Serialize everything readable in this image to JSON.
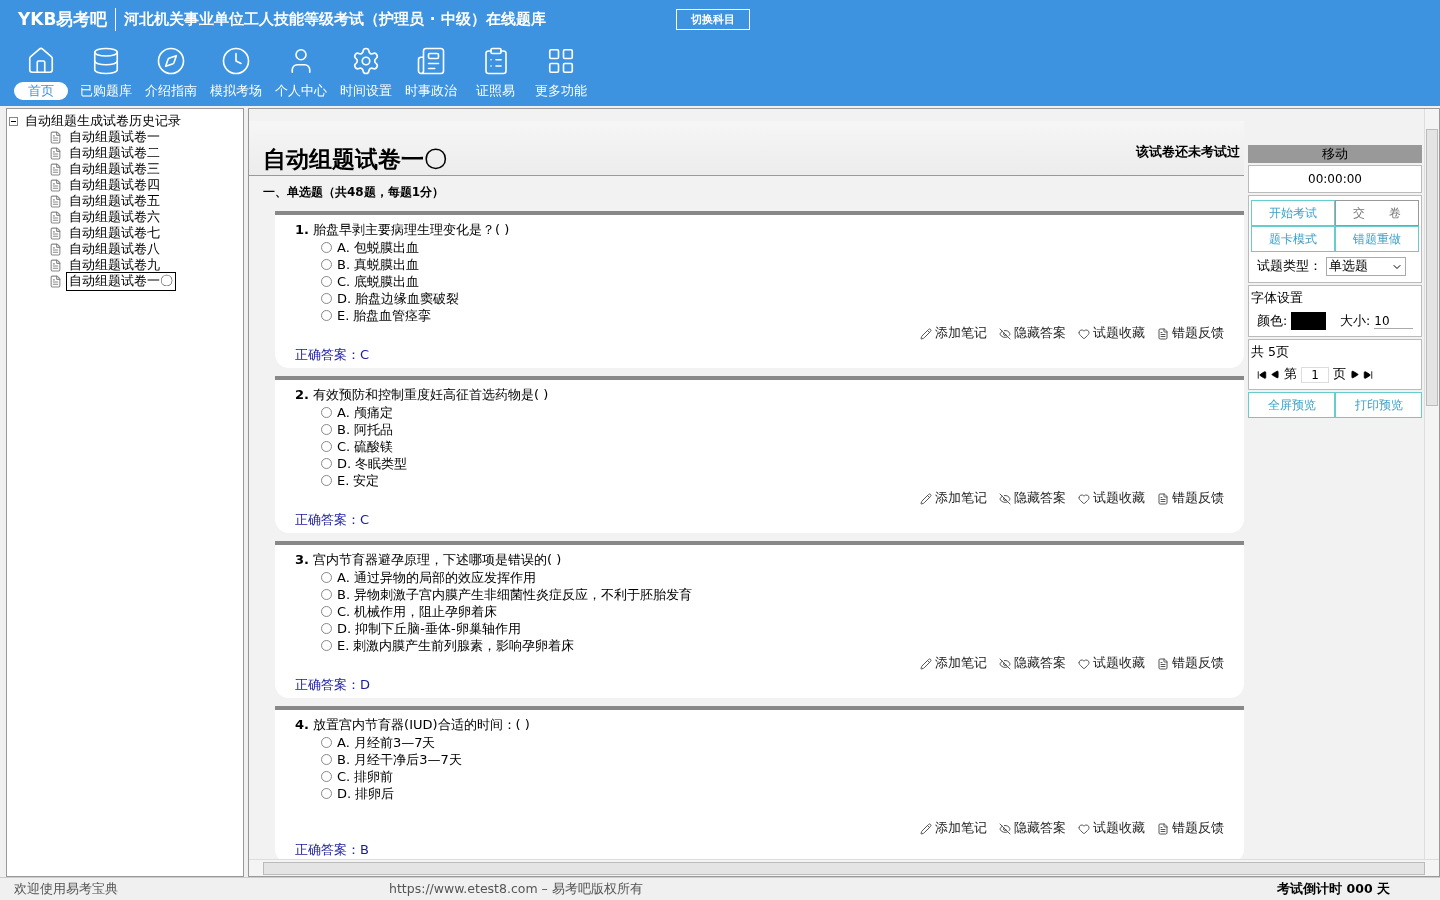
{
  "header": {
    "logo": "YKB易考吧",
    "title": "河北机关事业单位工人技能等级考试（护理员 · 中级）在线题库",
    "switch_button": "切换科目"
  },
  "toolbar": [
    {
      "label": "首页",
      "selected": true
    },
    {
      "label": "已购题库",
      "selected": false
    },
    {
      "label": "介绍指南",
      "selected": false
    },
    {
      "label": "模拟考场",
      "selected": false
    },
    {
      "label": "个人中心",
      "selected": false
    },
    {
      "label": "时间设置",
      "selected": false
    },
    {
      "label": "时事政治",
      "selected": false
    },
    {
      "label": "证照易",
      "selected": false
    },
    {
      "label": "更多功能",
      "selected": false
    }
  ],
  "tree": {
    "label": "自动组题生成试卷历史记录",
    "expanded": true,
    "children": [
      {
        "label": "自动组题试卷一",
        "selected": false
      },
      {
        "label": "自动组题试卷二",
        "selected": false
      },
      {
        "label": "自动组题试卷三",
        "selected": false
      },
      {
        "label": "自动组题试卷四",
        "selected": false
      },
      {
        "label": "自动组题试卷五",
        "selected": false
      },
      {
        "label": "自动组题试卷六",
        "selected": false
      },
      {
        "label": "自动组题试卷七",
        "selected": false
      },
      {
        "label": "自动组题试卷八",
        "selected": false
      },
      {
        "label": "自动组题试卷九",
        "selected": false
      },
      {
        "label": "自动组题试卷一〇",
        "selected": true
      }
    ]
  },
  "paper": {
    "title": "自动组题试卷一〇",
    "status_note": "该试卷还未考试过",
    "section_heading": "一、单选题（共48题，每题1分）",
    "questions": [
      {
        "text": "**1.** 胎盘早剥主要病理生理变化是？( )",
        "options": [
          {
            "text": "A. 包蜕膜出血",
            "checked": false
          },
          {
            "text": "B. 真蜕膜出血",
            "checked": false
          },
          {
            "text": "C. 底蜕膜出血",
            "checked": false
          },
          {
            "text": "D. 胎盘边缘血窦破裂",
            "checked": false
          },
          {
            "text": "E. 胎盘血管痉挛",
            "checked": false
          }
        ],
        "answer": "正确答案：C",
        "actions": [
          "添加笔记",
          "隐藏答案",
          "试题收藏",
          "错题反馈"
        ]
      },
      {
        "text": "**2.** 有效预防和控制重度妊高征首选药物是( )",
        "options": [
          {
            "text": "A. 颅痛定",
            "checked": false
          },
          {
            "text": "B. 阿托品",
            "checked": false
          },
          {
            "text": "C. 硫酸镁",
            "checked": false
          },
          {
            "text": "D. 冬眠类型",
            "checked": false
          },
          {
            "text": "E. 安定",
            "checked": false
          }
        ],
        "answer": "正确答案：C",
        "actions": [
          "添加笔记",
          "隐藏答案",
          "试题收藏",
          "错题反馈"
        ]
      },
      {
        "text": "**3.** 宫内节育器避孕原理，下述哪项是错误的( )",
        "options": [
          {
            "text": "A. 通过异物的局部的效应发挥作用",
            "checked": false
          },
          {
            "text": "B. 异物刺激子宫内膜产生非细菌性炎症反应，不利于胚胎发育",
            "checked": false
          },
          {
            "text": "C. 机械作用，阻止孕卵着床",
            "checked": false
          },
          {
            "text": "D. 抑制下丘脑-垂体-卵巢轴作用",
            "checked": false
          },
          {
            "text": "E. 刺激内膜产生前列腺素，影响孕卵着床",
            "checked": false
          }
        ],
        "answer": "正确答案：D",
        "actions": [
          "添加笔记",
          "隐藏答案",
          "试题收藏",
          "错题反馈"
        ]
      },
      {
        "text": "**4.** 放置宫内节育器(IUD)合适的时间：( )",
        "options": [
          {
            "text": "A. 月经前3—7天",
            "checked": false
          },
          {
            "text": "B. 月经干净后3—7天",
            "checked": false
          },
          {
            "text": "C. 排卵前",
            "checked": false
          },
          {
            "text": "D. 排卵后",
            "checked": false
          }
        ],
        "answer": "正确答案：B",
        "actions": [
          "添加笔记",
          "隐藏答案",
          "试题收藏",
          "错题反馈"
        ]
      }
    ]
  },
  "panel": {
    "title": "移动",
    "timer": "00:00:00",
    "buttons": [
      "开始考试",
      "交　　卷",
      "题卡模式",
      "错题重做"
    ],
    "type_label": "试题类型：",
    "type_value": "单选题",
    "font_group": "字体设置",
    "color_label": "颜色:",
    "size_label": "大小:",
    "size_value": "10",
    "pages_title": "共 5页",
    "page_prefix": "第",
    "page_value": "1",
    "page_suffix": "页",
    "bottom_buttons": [
      "全屏预览",
      "打印预览"
    ]
  },
  "status_bar": {
    "left": "欢迎使用易考宝典",
    "center": "https://www.etest8.com – 易考吧版权所有",
    "right": "考试倒计时 000 天"
  }
}
